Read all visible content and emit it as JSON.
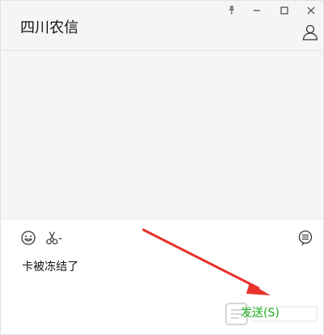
{
  "window": {
    "title": "四川农信",
    "controls": [
      "pin-icon",
      "minimize-icon",
      "maximize-icon",
      "close-icon"
    ]
  },
  "toolbar": {
    "icons": [
      "emoji-icon",
      "screenshot-scissors-icon",
      "chat-history-icon"
    ]
  },
  "composer": {
    "draft_text": "卡被冻结了",
    "send_label": "发送(S)"
  },
  "colors": {
    "send_text": "#1aad19",
    "annotation_arrow": "#e8322b"
  }
}
